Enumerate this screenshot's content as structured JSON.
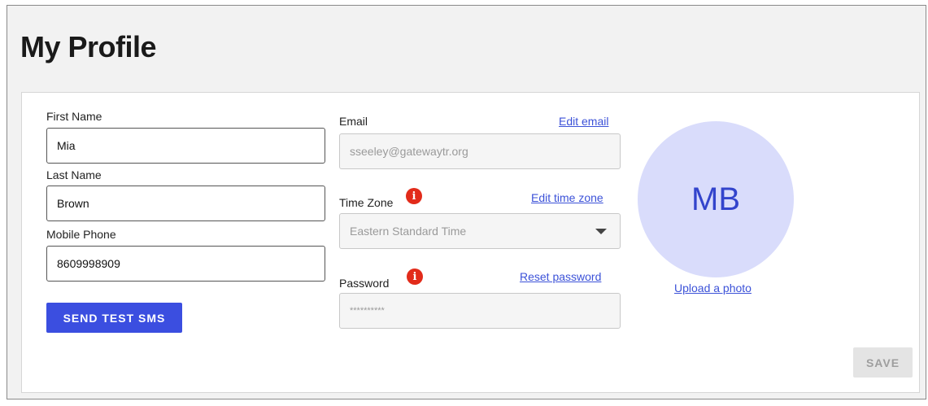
{
  "page": {
    "title": "My Profile"
  },
  "first_name": {
    "label": "First Name",
    "value": "Mia"
  },
  "last_name": {
    "label": "Last Name",
    "value": "Brown"
  },
  "mobile_phone": {
    "label": "Mobile Phone",
    "value": "8609998909"
  },
  "send_test_sms": {
    "label": "SEND TEST SMS"
  },
  "email": {
    "label": "Email",
    "value": "sseeley@gatewaytr.org",
    "edit_link": "Edit email"
  },
  "time_zone": {
    "label": "Time Zone",
    "value": "Eastern Standard Time",
    "edit_link": "Edit time zone",
    "info_glyph": "i"
  },
  "password": {
    "label": "Password",
    "value": "**********",
    "reset_link": "Reset password",
    "info_glyph": "i"
  },
  "avatar": {
    "initials": "MB",
    "upload_link": "Upload a photo"
  },
  "save": {
    "label": "SAVE"
  },
  "colors": {
    "accent": "#3b4ee0",
    "link": "#3c52d8",
    "warning": "#e22b1a",
    "avatar_bg": "#d9dcfb",
    "disabled_bg": "#e4e4e4"
  }
}
